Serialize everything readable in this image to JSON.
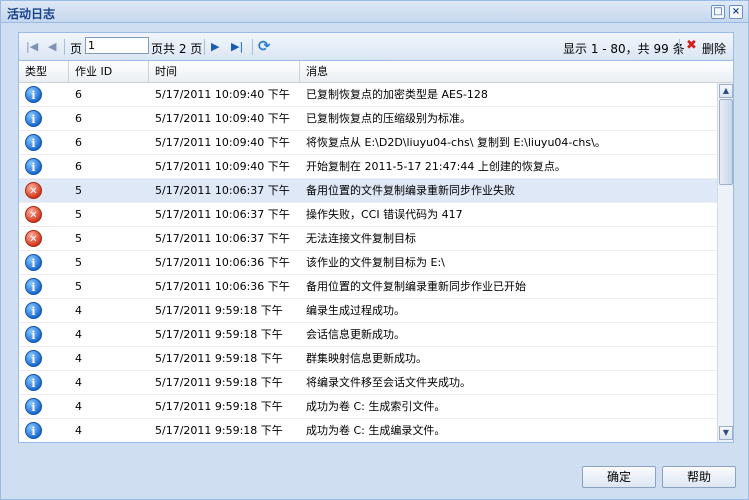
{
  "window": {
    "title": "活动日志",
    "maximize_glyph": "□",
    "close_glyph": "×"
  },
  "pager": {
    "first_glyph": "|◀",
    "prev_glyph": "◀",
    "page_label": "页",
    "page_value": "1",
    "page_total": "页共 2 页",
    "next_glyph": "▶",
    "last_glyph": "▶|",
    "refresh_glyph": "⟳",
    "display_info": "显示 1 - 80，共 99 条",
    "delete_icon": "✖",
    "delete_label": "删除"
  },
  "columns": {
    "type": "类型",
    "job_id": "作业 ID",
    "time": "时间",
    "message": "消息"
  },
  "rows": [
    {
      "type": "info",
      "glyph": "i",
      "job": "6",
      "time": "5/17/2011 10:09:40 下午",
      "msg": "已复制恢复点的加密类型是 AES-128"
    },
    {
      "type": "info",
      "glyph": "i",
      "job": "6",
      "time": "5/17/2011 10:09:40 下午",
      "msg": "已复制恢复点的压缩级别为标准。"
    },
    {
      "type": "info",
      "glyph": "i",
      "job": "6",
      "time": "5/17/2011 10:09:40 下午",
      "msg": "将恢复点从 E:\\D2D\\liuyu04-chs\\ 复制到 E:\\liuyu04-chs\\。"
    },
    {
      "type": "info",
      "glyph": "i",
      "job": "6",
      "time": "5/17/2011 10:09:40 下午",
      "msg": "开始复制在 2011-5-17 21:47:44 上创建的恢复点。"
    },
    {
      "type": "error",
      "glyph": "✕",
      "job": "5",
      "time": "5/17/2011 10:06:37 下午",
      "msg": "备用位置的文件复制编录重新同步作业失败"
    },
    {
      "type": "error",
      "glyph": "✕",
      "job": "5",
      "time": "5/17/2011 10:06:37 下午",
      "msg": "操作失败，CCI 错误代码为 417"
    },
    {
      "type": "error",
      "glyph": "✕",
      "job": "5",
      "time": "5/17/2011 10:06:37 下午",
      "msg": "无法连接文件复制目标"
    },
    {
      "type": "info",
      "glyph": "i",
      "job": "5",
      "time": "5/17/2011 10:06:36 下午",
      "msg": "该作业的文件复制目标为 E:\\"
    },
    {
      "type": "info",
      "glyph": "i",
      "job": "5",
      "time": "5/17/2011 10:06:36 下午",
      "msg": "备用位置的文件复制编录重新同步作业已开始"
    },
    {
      "type": "info",
      "glyph": "i",
      "job": "4",
      "time": "5/17/2011 9:59:18 下午",
      "msg": "编录生成过程成功。"
    },
    {
      "type": "info",
      "glyph": "i",
      "job": "4",
      "time": "5/17/2011 9:59:18 下午",
      "msg": "会话信息更新成功。"
    },
    {
      "type": "info",
      "glyph": "i",
      "job": "4",
      "time": "5/17/2011 9:59:18 下午",
      "msg": "群集映射信息更新成功。"
    },
    {
      "type": "info",
      "glyph": "i",
      "job": "4",
      "time": "5/17/2011 9:59:18 下午",
      "msg": "将编录文件移至会话文件夹成功。"
    },
    {
      "type": "info",
      "glyph": "i",
      "job": "4",
      "time": "5/17/2011 9:59:18 下午",
      "msg": "成功为卷 C: 生成索引文件。"
    },
    {
      "type": "info",
      "glyph": "i",
      "job": "4",
      "time": "5/17/2011 9:59:18 下午",
      "msg": "成功为卷 C: 生成编录文件。"
    }
  ],
  "scrollbar": {
    "up_glyph": "▲",
    "down_glyph": "▼"
  },
  "footer": {
    "ok_label": "确定",
    "help_label": "帮助"
  }
}
